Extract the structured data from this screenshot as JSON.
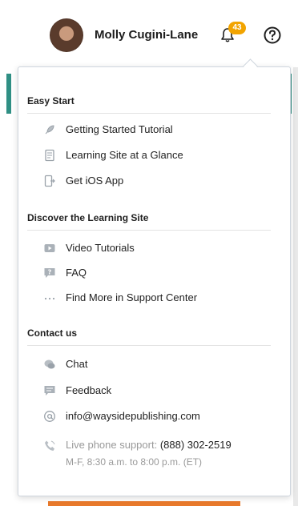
{
  "header": {
    "user_name": "Molly Cugini-Lane",
    "notification_count": "43"
  },
  "help_menu": {
    "sections": [
      {
        "title": "Easy Start",
        "items": [
          {
            "label": "Getting Started Tutorial",
            "icon": "rocket-icon"
          },
          {
            "label": "Learning Site at a Glance",
            "icon": "document-icon"
          },
          {
            "label": "Get iOS App",
            "icon": "mobile-app-icon"
          }
        ]
      },
      {
        "title": "Discover the Learning Site",
        "items": [
          {
            "label": "Video Tutorials",
            "icon": "video-icon"
          },
          {
            "label": "FAQ",
            "icon": "faq-icon"
          },
          {
            "label": "Find More in Support Center",
            "icon": "more-dots-icon"
          }
        ]
      },
      {
        "title": "Contact us",
        "items": [
          {
            "label": "Chat",
            "icon": "chat-icon"
          },
          {
            "label": "Feedback",
            "icon": "feedback-icon"
          },
          {
            "label": "info@waysidepublishing.com",
            "icon": "at-sign-icon"
          }
        ]
      }
    ],
    "phone": {
      "prefix": "Live phone support:",
      "number": "(888) 302-2519",
      "hours": "M-F, 8:30 a.m. to 8:00 p.m. (ET)"
    }
  },
  "colors": {
    "badge": "#f2a400",
    "accent_teal": "#2f8f84",
    "accent_orange": "#e8792b",
    "muted_text": "#9a9a9a"
  }
}
